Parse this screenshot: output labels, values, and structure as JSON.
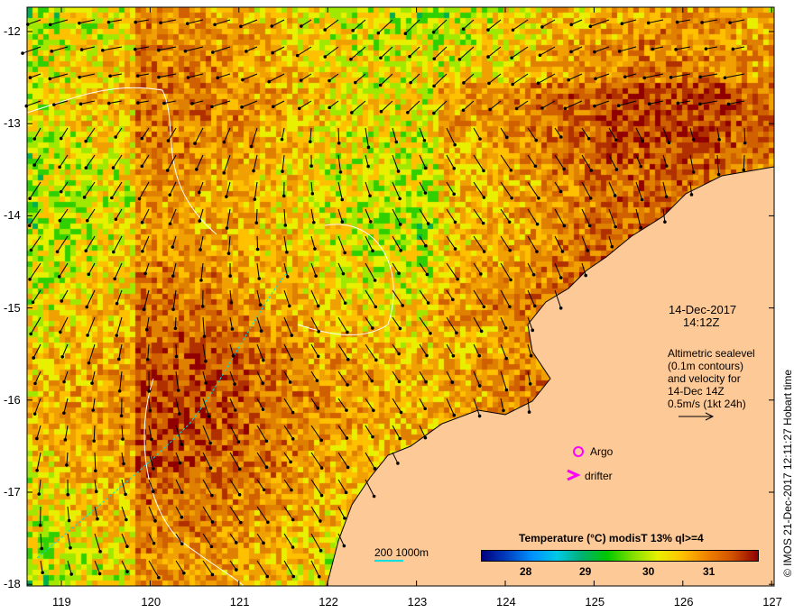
{
  "map": {
    "lon_ticks": [
      "119",
      "120",
      "121",
      "122",
      "123",
      "124",
      "125",
      "126",
      "127"
    ],
    "lat_ticks": [
      "-12",
      "-13",
      "-14",
      "-15",
      "-16",
      "-17",
      "-18"
    ],
    "lon_range": [
      118.6,
      127.0
    ],
    "lat_range": [
      -11.9,
      -18.0
    ]
  },
  "annotation": {
    "date": "14-Dec-2017",
    "time": "14:12Z",
    "desc_lines": [
      "Altimetric sealevel",
      "(0.1m contours)",
      "and velocity for",
      "14-Dec 14Z",
      "0.5m/s (1kt 24h)"
    ]
  },
  "legend": {
    "argo": "Argo",
    "drifter": "drifter",
    "argo_color": "#ff00ff"
  },
  "scale": {
    "label": "200  1000m",
    "color": "#00e0e0"
  },
  "colorbar": {
    "title": "Temperature (°C) modisT 13% ql>=4",
    "ticks": [
      "28",
      "29",
      "30",
      "31"
    ],
    "range": [
      27.3,
      31.8
    ]
  },
  "credit": "© IMOS 21-Dec-2017 12:11:27 Hobart time",
  "colors": {
    "land": "#fdc997",
    "contour": "#ffffff"
  }
}
